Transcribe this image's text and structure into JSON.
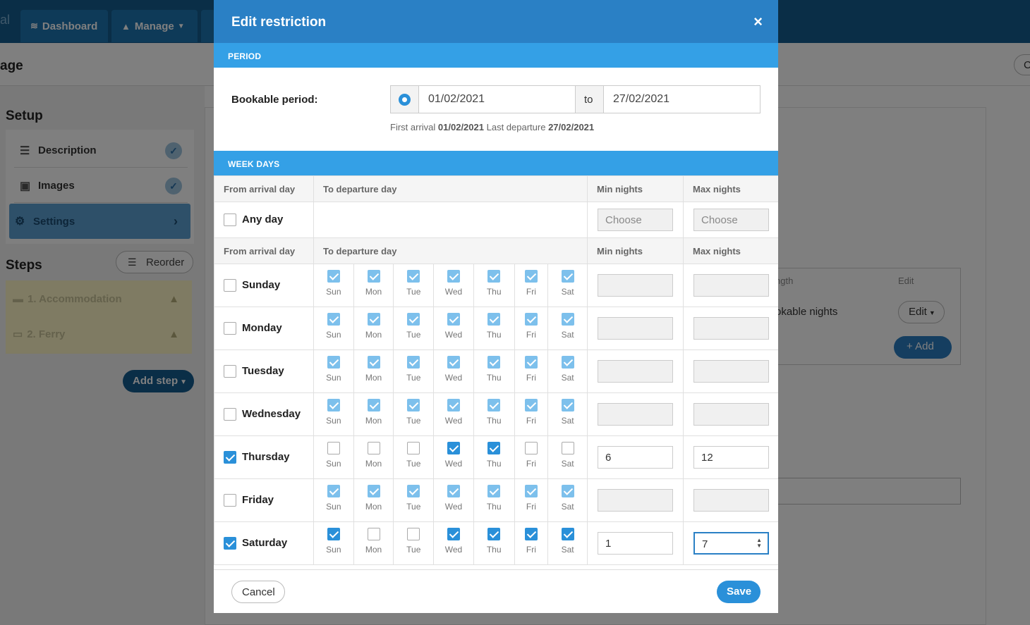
{
  "app": {
    "brand_fragment": "al",
    "nav": [
      {
        "label": "Dashboard",
        "icon": "wifi-icon"
      },
      {
        "label": "Manage",
        "icon": "mountain-icon"
      }
    ],
    "page_title": "age",
    "header_button": "C"
  },
  "sidebar": {
    "setup_heading": "Setup",
    "items": [
      {
        "label": "Description",
        "icon": "list-icon",
        "done": true
      },
      {
        "label": "Images",
        "icon": "image-icon",
        "done": true
      },
      {
        "label": "Settings",
        "icon": "gear-icon",
        "active": true
      }
    ],
    "steps_heading": "Steps",
    "reorder_label": "Reorder",
    "steps": [
      {
        "label": "1. Accommodation",
        "icon": "bed-icon"
      },
      {
        "label": "2. Ferry",
        "icon": "ferry-icon"
      }
    ],
    "add_step_label": "Add step"
  },
  "background_table": {
    "col_length": "ngth",
    "col_edit": "Edit",
    "row_text": "okable nights",
    "edit_button": "Edit",
    "add_button": "Add"
  },
  "modal": {
    "title": "Edit restriction",
    "close_glyph": "×",
    "period_band": "PERIOD",
    "bookable_label": "Bookable period:",
    "date_from": "01/02/2021",
    "to_label": "to",
    "date_to": "27/02/2021",
    "hint_prefix": "First arrival",
    "hint_first": "01/02/2021",
    "hint_mid": "Last departure",
    "hint_last": "27/02/2021",
    "weekdays_band": "WEEK DAYS",
    "headers": {
      "from": "From arrival day",
      "to": "To departure day",
      "min": "Min nights",
      "max": "Max nights"
    },
    "any_day": {
      "label": "Any day",
      "checked": false,
      "min_placeholder": "Choose",
      "max_placeholder": "Choose"
    },
    "dep_days": [
      "Sun",
      "Mon",
      "Tue",
      "Wed",
      "Thu",
      "Fri",
      "Sat"
    ],
    "rows": [
      {
        "label": "Sunday",
        "checked": false,
        "deps": [
          true,
          true,
          true,
          true,
          true,
          true,
          true
        ],
        "min": "",
        "max": ""
      },
      {
        "label": "Monday",
        "checked": false,
        "deps": [
          true,
          true,
          true,
          true,
          true,
          true,
          true
        ],
        "min": "",
        "max": ""
      },
      {
        "label": "Tuesday",
        "checked": false,
        "deps": [
          true,
          true,
          true,
          true,
          true,
          true,
          true
        ],
        "min": "",
        "max": ""
      },
      {
        "label": "Wednesday",
        "checked": false,
        "deps": [
          true,
          true,
          true,
          true,
          true,
          true,
          true
        ],
        "min": "",
        "max": ""
      },
      {
        "label": "Thursday",
        "checked": true,
        "deps": [
          false,
          false,
          false,
          true,
          true,
          false,
          false
        ],
        "min": "6",
        "max": "12"
      },
      {
        "label": "Friday",
        "checked": false,
        "deps": [
          true,
          true,
          true,
          true,
          true,
          true,
          true
        ],
        "min": "",
        "max": ""
      },
      {
        "label": "Saturday",
        "checked": true,
        "deps": [
          true,
          false,
          false,
          true,
          true,
          true,
          true
        ],
        "min": "1",
        "max": "7"
      }
    ],
    "cancel_label": "Cancel",
    "save_label": "Save"
  },
  "colors": {
    "primary": "#2a80c5",
    "band": "#34a0e6",
    "check": "#2a90d9",
    "nav": "#155c8f"
  }
}
